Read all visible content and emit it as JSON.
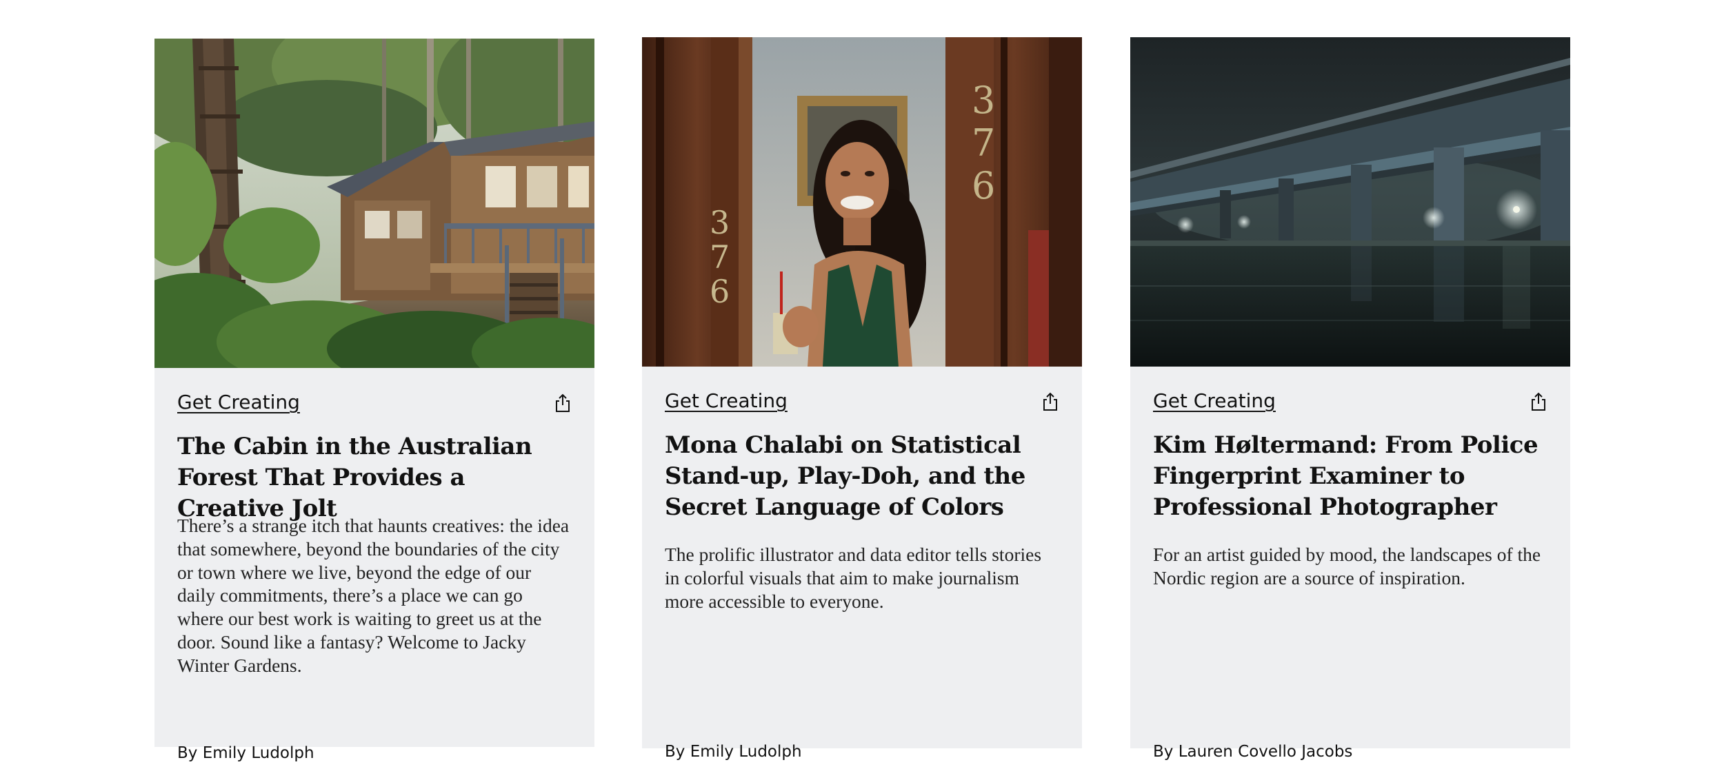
{
  "cards": [
    {
      "category": "Get Creating",
      "share_icon": "share-icon",
      "title": "The Cabin in the Australian Forest That Provides a Creative Jolt",
      "summary": "There’s a strange itch that haunts creatives: the idea that somewhere, beyond the boundaries of the city or town where we live, beyond the edge of our daily commitments, there’s a place we can go where our best work is waiting to greet us at the door. Sound like a fantasy? Welcome to Jacky Winter Gardens.",
      "byline": "By Emily Ludolph",
      "image_subject": "cabin-in-forest"
    },
    {
      "category": "Get Creating",
      "share_icon": "share-icon",
      "title": "Mona Chalabi on Statistical Stand-up, Play-Doh, and the Secret Language of Colors",
      "summary": "The prolific illustrator and data editor tells stories in colorful visuals that aim to make journalism more accessible to everyone.",
      "byline": "By Emily Ludolph",
      "image_subject": "woman-in-doorway",
      "image_text": {
        "door_number_right": [
          "3",
          "7",
          "6"
        ],
        "door_number_left": [
          "3",
          "7",
          "6"
        ]
      }
    },
    {
      "category": "Get Creating",
      "share_icon": "share-icon",
      "title": "Kim Høltermand: From Police Fingerprint Examiner to Professional Photographer",
      "summary": "For an artist guided by mood, the landscapes of the Nordic region are a source of inspiration.",
      "byline": "By Lauren Covello Jacobs",
      "image_subject": "bridge-at-night"
    }
  ]
}
